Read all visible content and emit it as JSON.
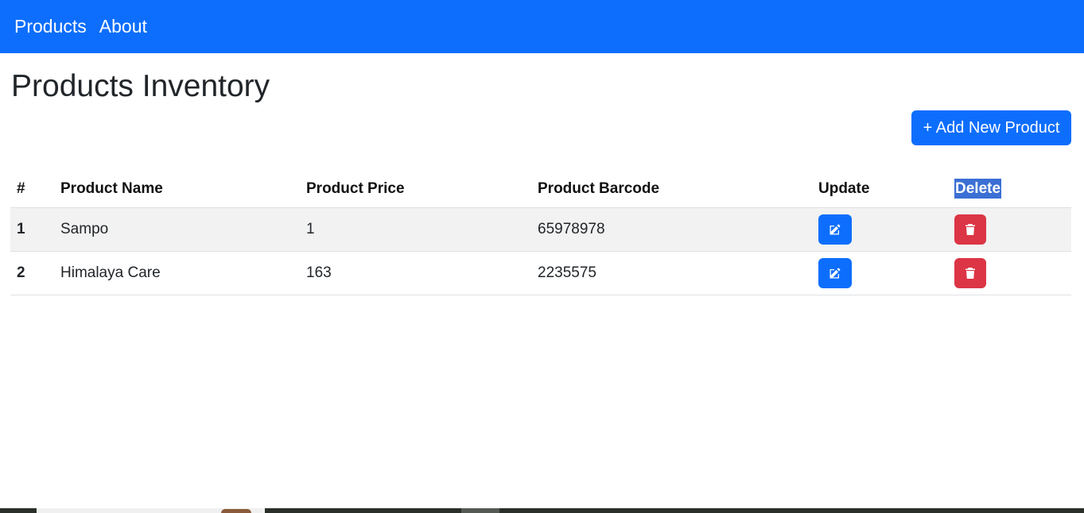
{
  "nav": {
    "items": [
      {
        "label": "Products"
      },
      {
        "label": "About"
      }
    ]
  },
  "page": {
    "title": "Products Inventory",
    "add_button_label": "+ Add New Product"
  },
  "table": {
    "headers": {
      "index": "#",
      "name": "Product Name",
      "price": "Product Price",
      "barcode": "Product Barcode",
      "update": "Update",
      "delete": "Delete"
    },
    "rows": [
      {
        "index": "1",
        "name": "Sampo",
        "price": "1",
        "barcode": "65978978"
      },
      {
        "index": "2",
        "name": "Himalaya Care",
        "price": "163",
        "barcode": "2235575"
      }
    ]
  },
  "icons": {
    "edit": "edit-icon",
    "delete": "trash-icon"
  },
  "colors": {
    "primary": "#0d6efd",
    "danger": "#dc3545"
  }
}
